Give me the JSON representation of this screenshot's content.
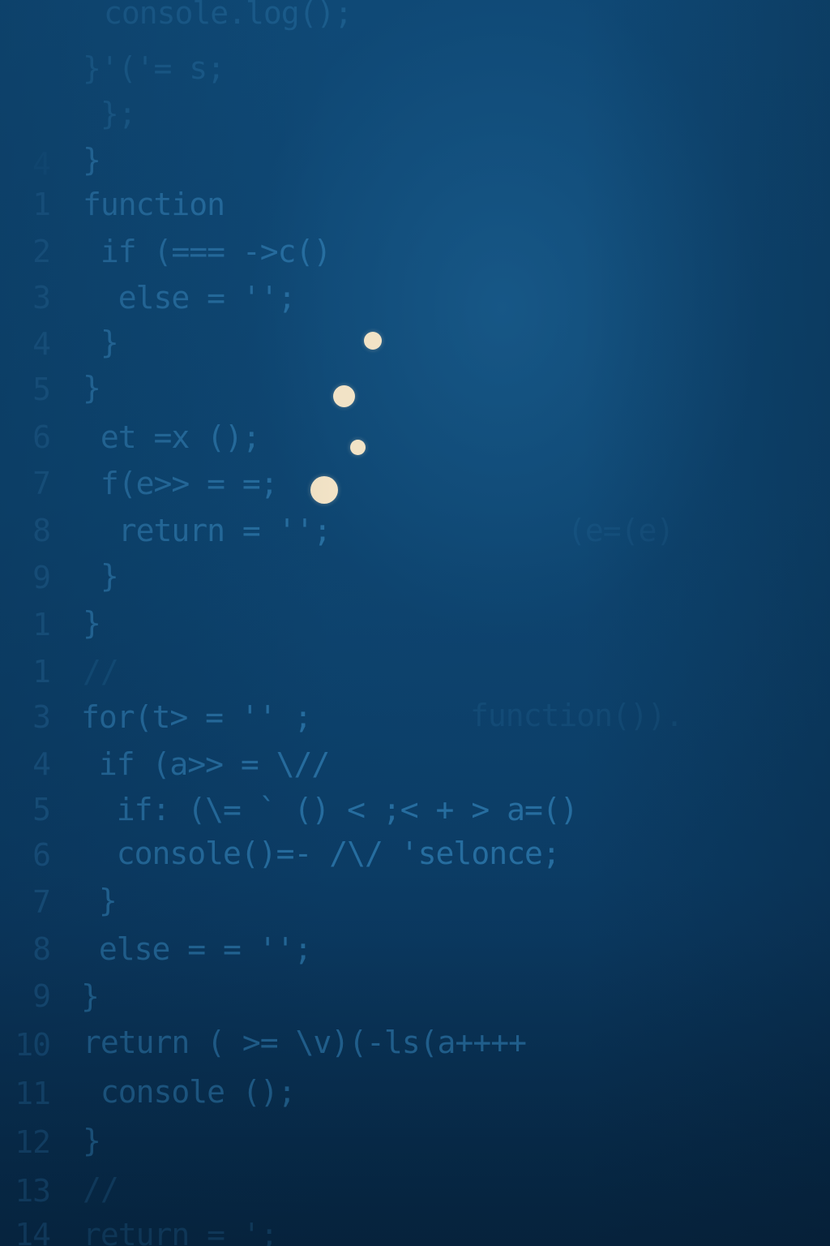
{
  "code_lines": [
    {
      "n": "",
      "text": "console.log();"
    },
    {
      "n": "",
      "text": "}'('= s;"
    },
    {
      "n": "",
      "text": " };"
    },
    {
      "n": "4",
      "text": "}"
    },
    {
      "n": "1",
      "text": "function"
    },
    {
      "n": "2",
      "text": " if (=== ->c()"
    },
    {
      "n": "3",
      "text": "  else = '';"
    },
    {
      "n": "4",
      "text": " }"
    },
    {
      "n": "5",
      "text": "}"
    },
    {
      "n": "6",
      "text": " et =x ();"
    },
    {
      "n": "7",
      "text": " f(e>> = =;"
    },
    {
      "n": "8",
      "text": "  return = '';"
    },
    {
      "n": "9",
      "text": " }"
    },
    {
      "n": "1",
      "text": "}"
    },
    {
      "n": "1",
      "text": "//"
    },
    {
      "n": "3",
      "text": "for(t> = '' ;"
    },
    {
      "n": "4",
      "text": " if (a>> = \\//"
    },
    {
      "n": "5",
      "text": "  if: (\\= ` () < ;< + > a=()"
    },
    {
      "n": "6",
      "text": "  console()=- /\\/ 'selonce;"
    },
    {
      "n": "7",
      "text": " }"
    },
    {
      "n": "8",
      "text": " else = = '';"
    },
    {
      "n": "9",
      "text": "}"
    },
    {
      "n": "10",
      "text": "return ( >= \\v)(-ls(a++++"
    },
    {
      "n": "11",
      "text": " console ();"
    },
    {
      "n": "12",
      "text": "}"
    },
    {
      "n": "13",
      "text": "//"
    },
    {
      "n": "14",
      "text": "return = ';"
    }
  ],
  "ghost_text": [
    {
      "text": "function())."
    },
    {
      "text": "(e=(e)"
    }
  ],
  "dots": {
    "color": "#f2e3c6",
    "count": 4
  },
  "colors": {
    "background": "#0d4570",
    "code": "#2a73a6",
    "line_numbers": "#1f5d8c"
  }
}
